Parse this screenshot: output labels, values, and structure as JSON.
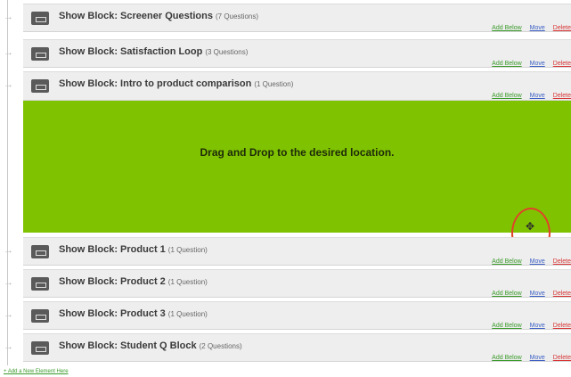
{
  "blocks_above": [
    {
      "title": "Show Block: Screener Questions",
      "count": "(7 Questions)"
    },
    {
      "title": "Show Block: Satisfaction Loop",
      "count": "(3 Questions)"
    },
    {
      "title": "Show Block: Intro to product comparison",
      "count": "(1 Question)"
    }
  ],
  "drop_zone": {
    "text": "Drag and Drop to the desired location."
  },
  "cursor_glyph": "✥",
  "blocks_below": [
    {
      "title": "Show Block: Product 1",
      "count": "(1 Question)"
    },
    {
      "title": "Show Block: Product 2",
      "count": "(1 Question)"
    },
    {
      "title": "Show Block: Product 3",
      "count": "(1 Question)"
    },
    {
      "title": "Show Block: Student Q Block",
      "count": "(2 Questions)"
    }
  ],
  "actions": {
    "add_below": "Add Below",
    "move": "Move",
    "delete": "Delete"
  },
  "add_new": "+ Add a New Element Here",
  "colors": {
    "drop_zone": "#7fc300",
    "highlight": "#e0432a",
    "add_link": "#3a9a2a",
    "move_link": "#3b5fc4",
    "delete_link": "#d83434"
  }
}
